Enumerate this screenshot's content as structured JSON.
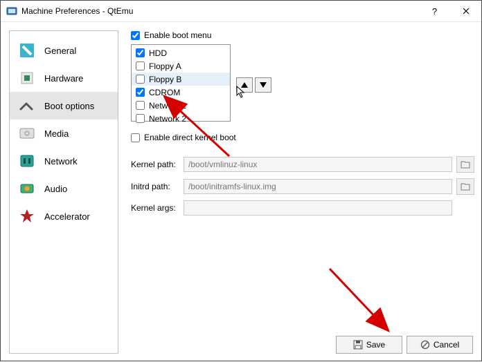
{
  "titlebar": {
    "title": "Machine Preferences - QtEmu"
  },
  "sidebar": {
    "items": [
      {
        "label": "General"
      },
      {
        "label": "Hardware"
      },
      {
        "label": "Boot options"
      },
      {
        "label": "Media"
      },
      {
        "label": "Network"
      },
      {
        "label": "Audio"
      },
      {
        "label": "Accelerator"
      }
    ]
  },
  "main": {
    "enable_boot_menu_label": "Enable boot menu",
    "boot_items": [
      {
        "label": "HDD",
        "checked": true
      },
      {
        "label": "Floppy A",
        "checked": false
      },
      {
        "label": "Floppy B",
        "checked": false
      },
      {
        "label": "CDROM",
        "checked": true
      },
      {
        "label": "Network 1",
        "checked": false
      },
      {
        "label": "Network 2",
        "checked": false
      }
    ],
    "enable_direct_kernel_label": "Enable direct kernel boot",
    "kernel_path_label": "Kernel path:",
    "kernel_path_placeholder": "/boot/vmlinuz-linux",
    "initrd_path_label": "Initrd path:",
    "initrd_path_placeholder": "/boot/initramfs-linux.img",
    "kernel_args_label": "Kernel args:"
  },
  "buttons": {
    "save": "Save",
    "cancel": "Cancel"
  }
}
